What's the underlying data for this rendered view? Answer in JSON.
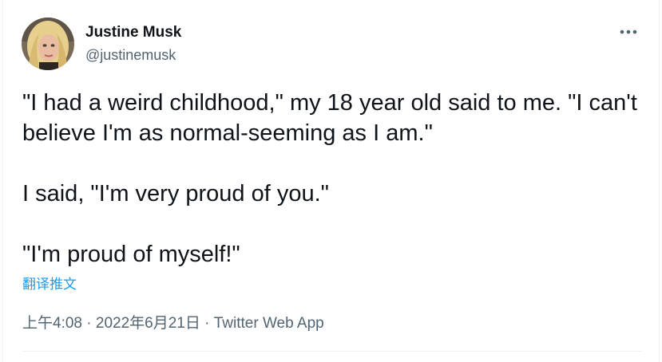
{
  "tweet": {
    "author": {
      "display_name": "Justine Musk",
      "handle": "@justinemusk",
      "avatar_icon": "profile-photo"
    },
    "more_icon": "ellipsis-icon",
    "text_paragraphs": [
      "\"I had a weird childhood,\" my 18 year old said to me. \"I can't believe I'm as normal-seeming as I am.\"",
      "I said, \"I'm very proud of you.\"",
      "\"I'm proud of myself!\""
    ],
    "translate_label": "翻译推文",
    "meta": {
      "time": "上午4:08",
      "separator": " · ",
      "date": "2022年6月21日",
      "source": "Twitter Web App"
    }
  },
  "colors": {
    "text_primary": "#0f1419",
    "text_secondary": "#536471",
    "link": "#1d9bf0",
    "border": "#eff3f4"
  }
}
